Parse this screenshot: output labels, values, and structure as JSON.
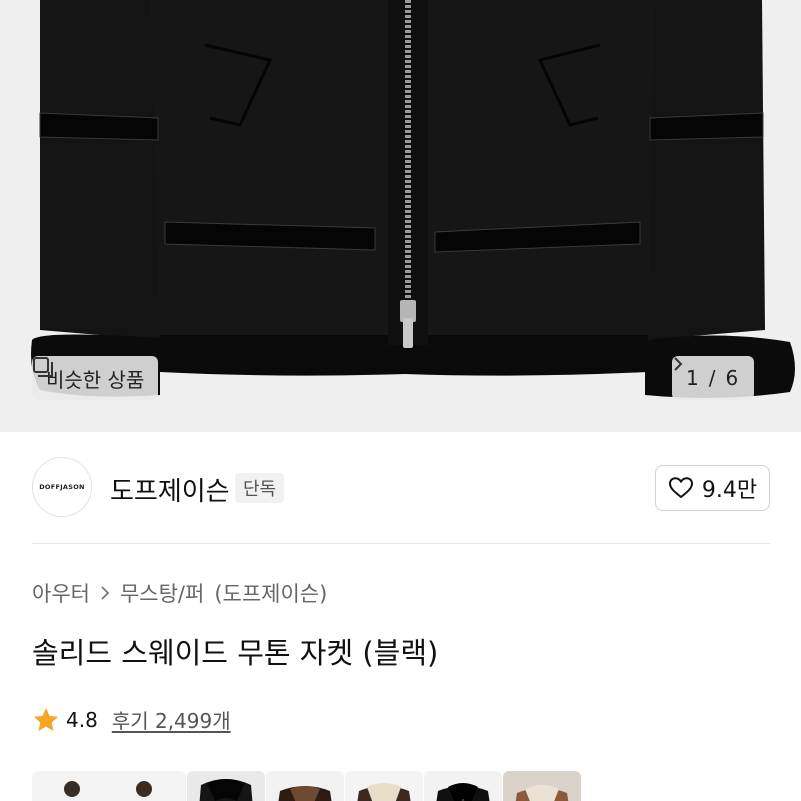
{
  "gallery": {
    "similar_label": "비슷한 상품",
    "similar_icon": "similar-items-icon",
    "current": "1",
    "separator": "/",
    "total": "6",
    "next_icon": "chevron-right-icon"
  },
  "brand": {
    "logo_text": "DOFFJASON",
    "name": "도프제이슨",
    "badge": "단독",
    "likes": "9.4만",
    "like_icon": "heart-outline-icon"
  },
  "product": {
    "breadcrumb": [
      "아우터",
      "무스탕/퍼",
      "(도프제이슨)"
    ],
    "title": "솔리드 스웨이드 무톤 자켓 (블랙)",
    "rating": "4.8",
    "reviews": "후기 2,499개",
    "star_color": "#f5a623"
  },
  "thumbnails": [
    {
      "name": "thumbnail-models"
    },
    {
      "name": "thumbnail-black-fur-collar"
    },
    {
      "name": "thumbnail-brown-jacket"
    },
    {
      "name": "thumbnail-beige-jacket"
    },
    {
      "name": "thumbnail-black-jacket"
    },
    {
      "name": "thumbnail-camel-jacket"
    }
  ]
}
